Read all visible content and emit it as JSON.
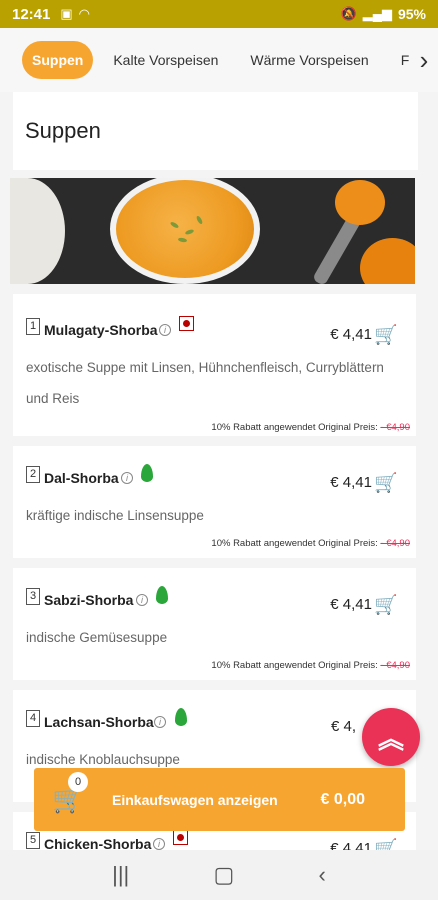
{
  "status": {
    "time": "12:41",
    "battery": "95%"
  },
  "tabs": [
    {
      "label": "Suppen",
      "active": true
    },
    {
      "label": "Kalte Vorspeisen",
      "active": false
    },
    {
      "label": "Wärme Vorspeisen",
      "active": false
    },
    {
      "label": "Fri",
      "active": false
    }
  ],
  "section": {
    "title": "Suppen"
  },
  "items": [
    {
      "number": "1",
      "name": "Mulagaty-Shorba",
      "price": "€ 4,41",
      "description": "exotische Suppe mit Linsen, Hühnchenfleisch, Curryblättern und Reis",
      "discount": "10% Rabatt angewendet Original Preis: ",
      "original_price": "- €4,90",
      "badge": "chili"
    },
    {
      "number": "2",
      "name": "Dal-Shorba",
      "price": "€ 4,41",
      "description": "kräftige indische Linsensuppe",
      "discount": "10% Rabatt angewendet Original Preis: ",
      "original_price": "- €4,90",
      "badge": "leaf"
    },
    {
      "number": "3",
      "name": "Sabzi-Shorba",
      "price": "€ 4,41",
      "description": "indische Gemüsesuppe",
      "discount": "10% Rabatt angewendet Original Preis: ",
      "original_price": "- €4,90",
      "badge": "leaf"
    },
    {
      "number": "4",
      "name": "Lachsan-Shorba",
      "price": "€ 4,",
      "description": "indische Knoblauchsuppe",
      "discount": "",
      "original_price": "",
      "badge": "leaf"
    },
    {
      "number": "5",
      "name": "Chicken-Shorba",
      "price": "€ 4,41",
      "description": "",
      "discount": "",
      "original_price": "",
      "badge": "chili"
    }
  ],
  "cart": {
    "count": "0",
    "label": "Einkaufswagen anzeigen",
    "total": "€ 0,00"
  },
  "colors": {
    "accent": "#f7a531",
    "cta": "#ea3257",
    "statusbar": "#b8a100"
  }
}
